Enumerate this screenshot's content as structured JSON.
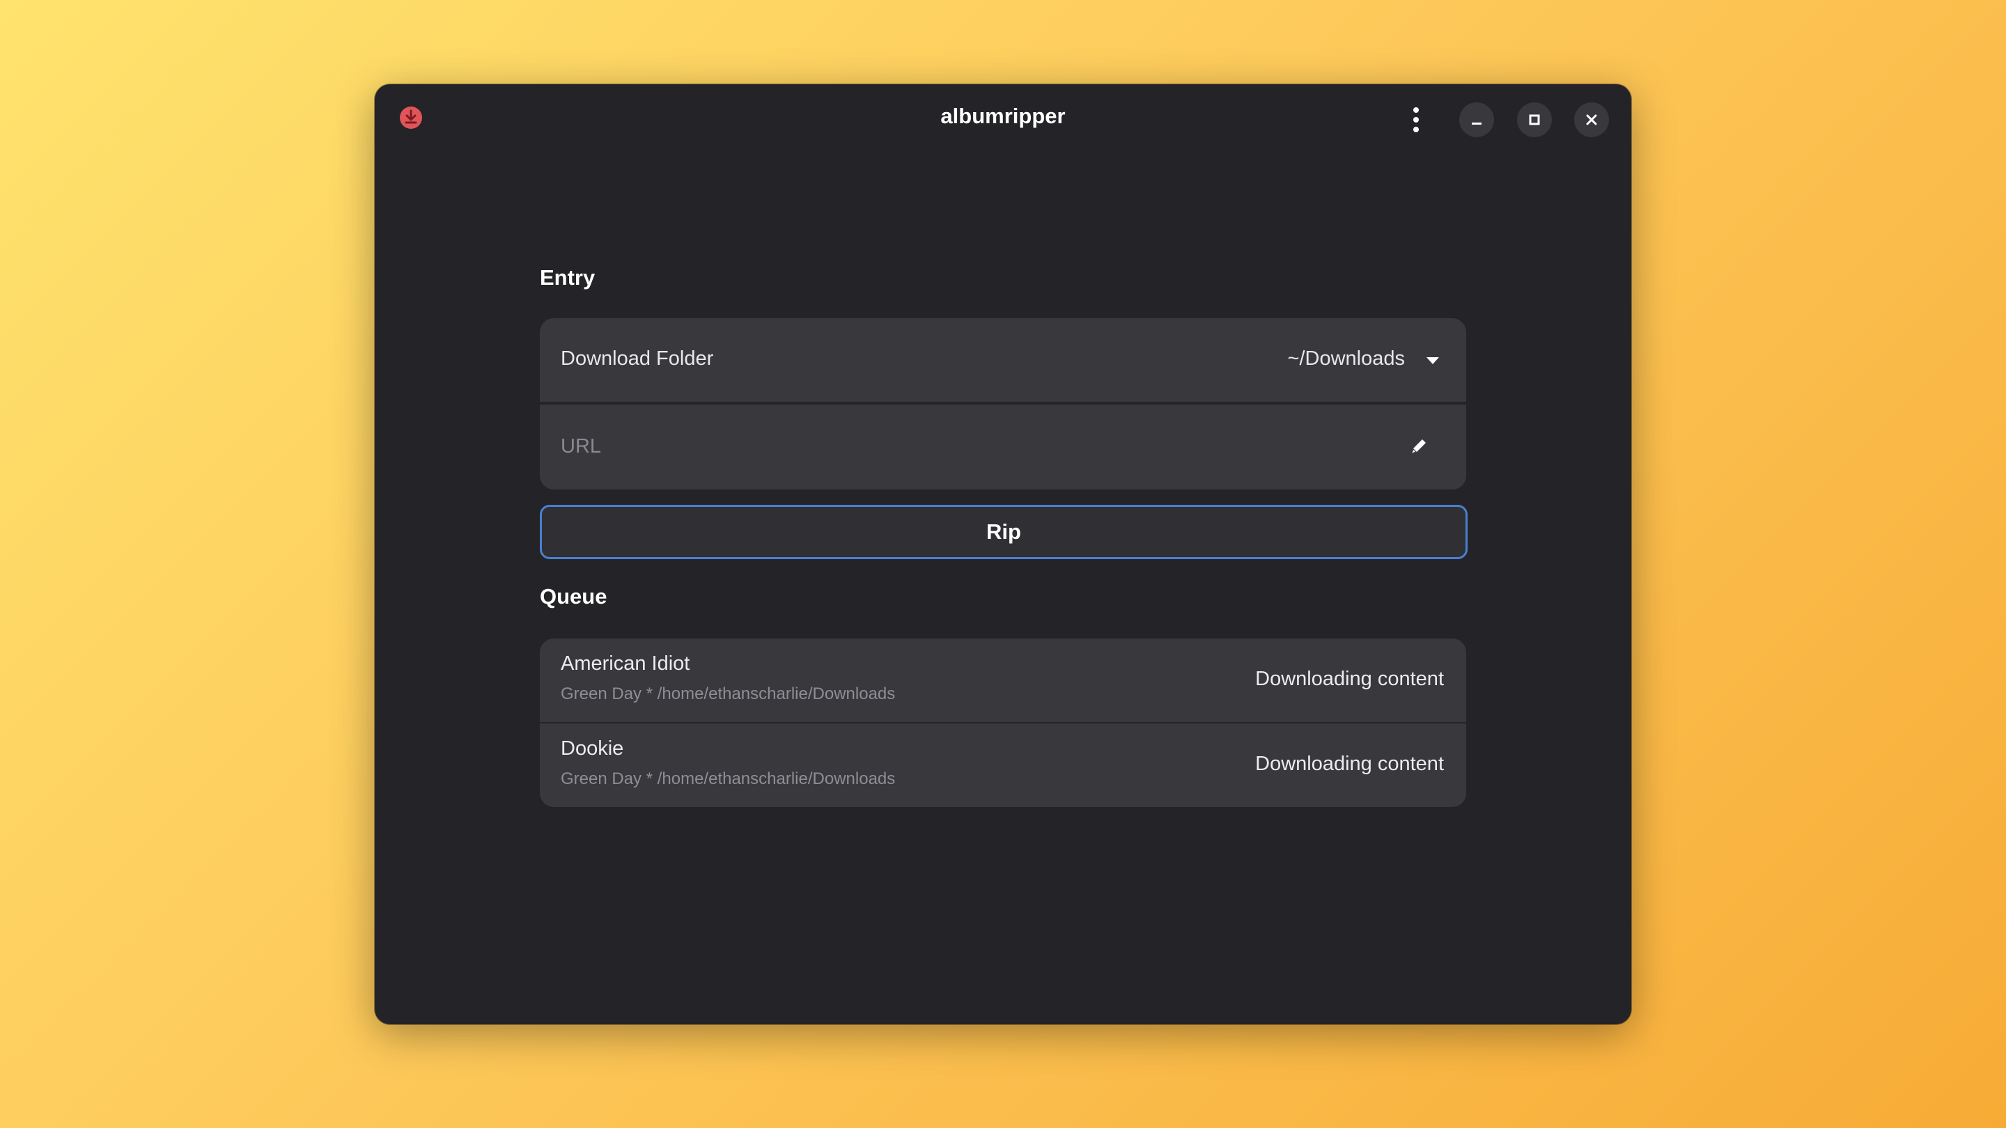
{
  "window": {
    "title": "albumripper"
  },
  "entry": {
    "heading": "Entry",
    "download_folder": {
      "label": "Download Folder",
      "value": "~/Downloads"
    },
    "url": {
      "placeholder": "URL"
    },
    "rip_label": "Rip"
  },
  "queue": {
    "heading": "Queue",
    "items": [
      {
        "title": "American Idiot",
        "subtitle": "Green Day * /home/ethanscharlie/Downloads",
        "status": "Downloading content"
      },
      {
        "title": "Dookie",
        "subtitle": "Green Day * /home/ethanscharlie/Downloads",
        "status": "Downloading content"
      }
    ]
  },
  "icons": {
    "app": "download-icon",
    "menu": "kebab-menu-icon",
    "minimize": "minimize-icon",
    "maximize": "maximize-icon",
    "close": "close-icon",
    "dropdown": "chevron-down-icon",
    "edit": "pencil-icon"
  },
  "colors": {
    "window_bg": "#242428",
    "row_bg": "#38383d",
    "accent_border": "#4a7fd0",
    "app_icon": "#e0555a"
  }
}
